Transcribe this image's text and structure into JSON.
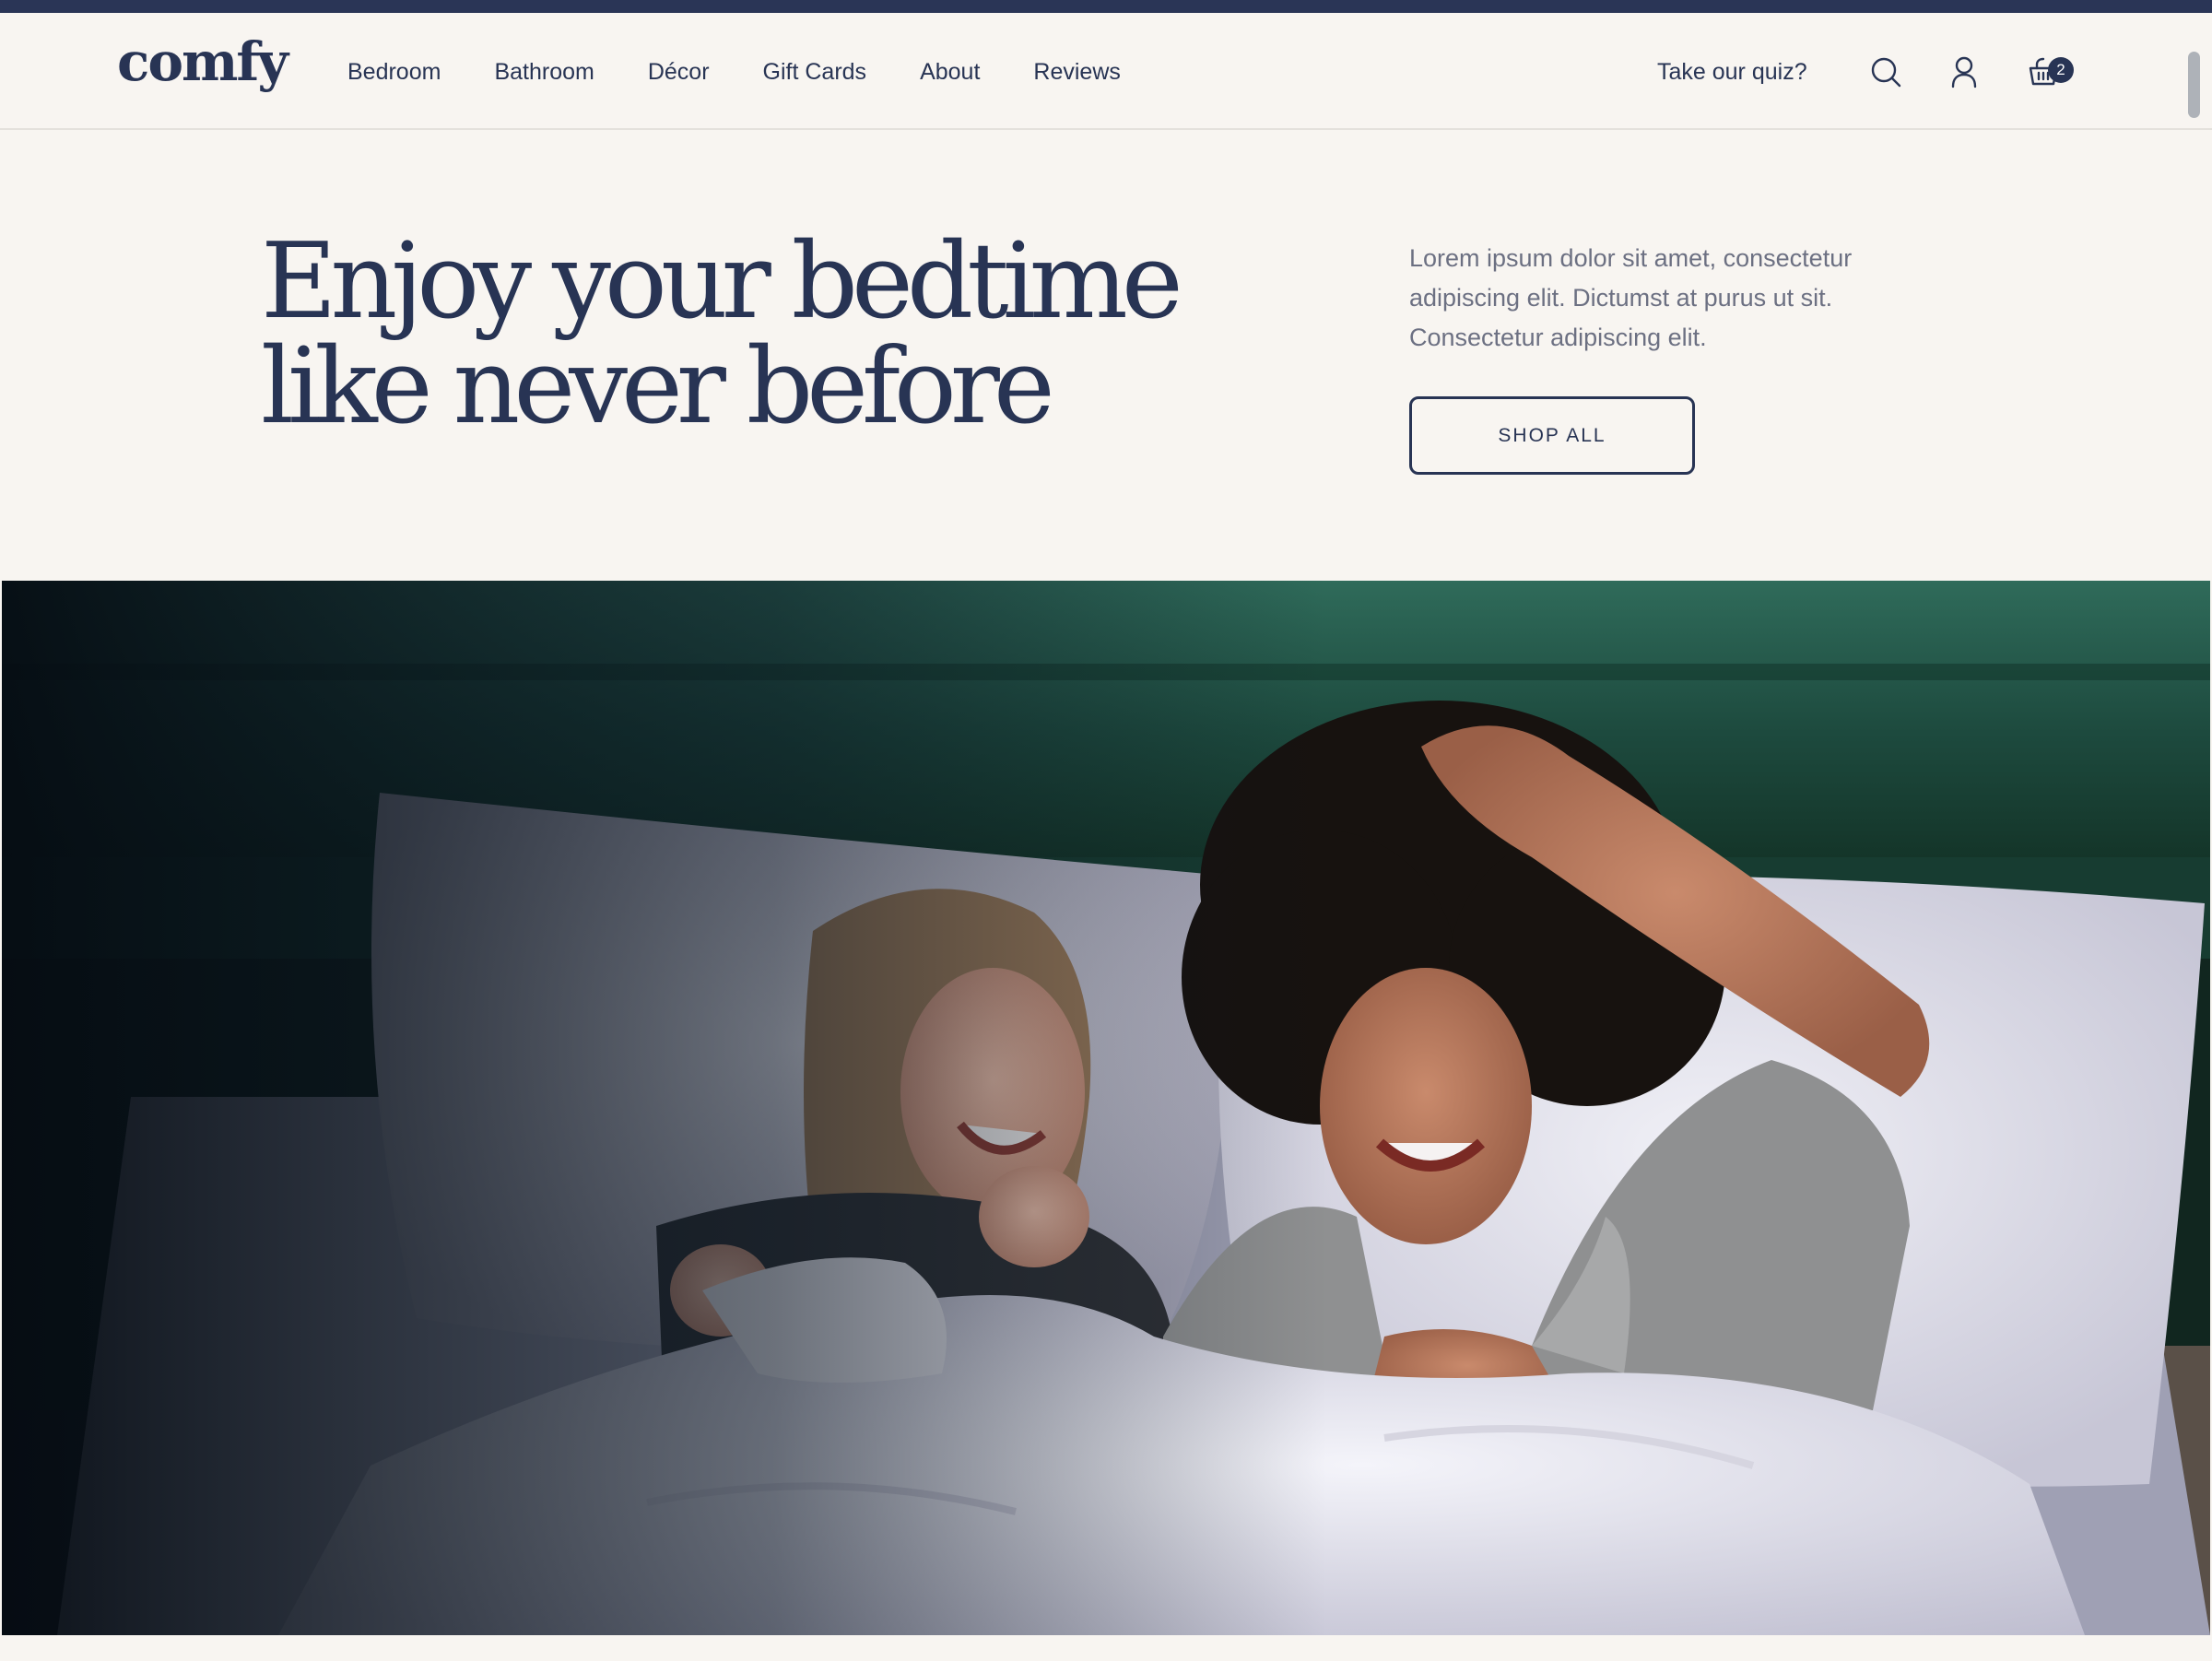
{
  "header": {
    "logo": "comfy",
    "nav": [
      "Bedroom",
      "Bathroom",
      "Décor",
      "Gift Cards",
      "About",
      "Reviews"
    ],
    "quiz_link": "Take our quiz?",
    "icons": [
      "search-icon",
      "account-icon",
      "cart-icon"
    ],
    "cart_count": "2"
  },
  "hero": {
    "title_line1": "Enjoy your bedtime",
    "title_line2": "like never before",
    "description": "Lorem ipsum dolor sit amet, consectetur adipiscing elit. Dictumst at purus ut sit. Consectetur adipiscing elit.",
    "cta_label": "SHOP ALL"
  },
  "colors": {
    "brand_navy": "#283454",
    "page_background": "#f8f5f1",
    "muted_text": "#6c7082",
    "headboard_green": "#1e4d40"
  }
}
